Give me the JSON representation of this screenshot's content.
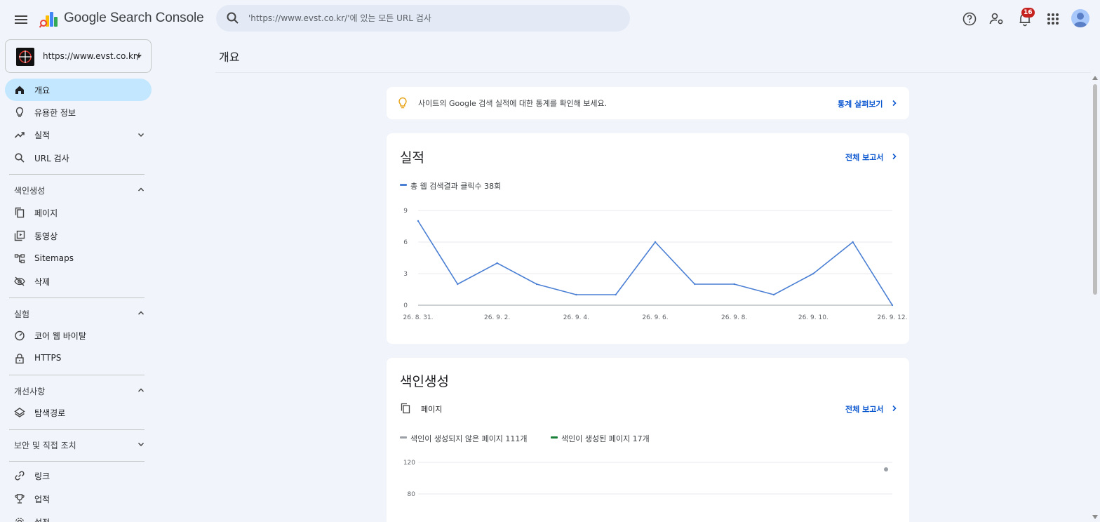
{
  "app": {
    "title": "Google Search Console"
  },
  "search": {
    "placeholder": "'https://www.evst.co.kr/'에 있는 모든 URL 검사"
  },
  "notifications": {
    "count": "16"
  },
  "property": {
    "url": "https://www.evst.co.kr/"
  },
  "sidebar": {
    "overview": "개요",
    "insights": "유용한 정보",
    "performance": "실적",
    "url_inspection": "URL 검사",
    "indexing_section": "색인생성",
    "pages": "페이지",
    "videos": "동영상",
    "sitemaps": "Sitemaps",
    "removals": "삭제",
    "experience_section": "실험",
    "core_web_vitals": "코어 웹 바이탈",
    "https": "HTTPS",
    "enhancements_section": "개선사항",
    "breadcrumbs": "탐색경로",
    "security_section": "보안 및 직접 조치",
    "links": "링크",
    "achievements": "업적",
    "settings": "설정"
  },
  "main": {
    "page_title": "개요",
    "tip": {
      "text": "사이트의 Google 검색 실적에 대한 통계를 확인해 보세요.",
      "link": "통계 살펴보기"
    },
    "performance": {
      "title": "실적",
      "link": "전체 보고서",
      "legend": "총 웹 검색결과 클릭수 38회"
    },
    "indexing": {
      "title": "색인생성",
      "subtitle": "페이지",
      "link": "전체 보고서",
      "legend_not_indexed": "색인이 생성되지 않은 페이지 111개",
      "legend_indexed": "색인이 생성된 페이지 17개"
    }
  },
  "colors": {
    "accent": "#0b57d0",
    "line": "#4a7fd4",
    "active_nav": "#c2e7ff",
    "indexed": "#188038",
    "not_indexed": "#9aa0a6"
  },
  "chart_data": [
    {
      "type": "line",
      "title": "",
      "x_tick_labels": [
        "26. 8. 31.",
        "26. 9. 2.",
        "26. 9. 4.",
        "26. 9. 6.",
        "26. 9. 8.",
        "26. 9. 10.",
        "26. 9. 12."
      ],
      "x": [
        "26. 8. 31.",
        "26. 9. 1.",
        "26. 9. 2.",
        "26. 9. 3.",
        "26. 9. 4.",
        "26. 9. 5.",
        "26. 9. 6.",
        "26. 9. 7.",
        "26. 9. 8.",
        "26. 9. 9.",
        "26. 9. 10.",
        "26. 9. 11.",
        "26. 9. 12."
      ],
      "series": [
        {
          "name": "총 웹 검색결과 클릭수 38회",
          "values": [
            8,
            2,
            4,
            2,
            1,
            1,
            6,
            2,
            2,
            1,
            3,
            6,
            0
          ]
        }
      ],
      "y_ticks": [
        0,
        3,
        6,
        9
      ],
      "ylim": [
        0,
        9
      ],
      "grid": true
    },
    {
      "type": "line",
      "title": "",
      "y_ticks": [
        80,
        120
      ],
      "series": [
        {
          "name": "색인이 생성되지 않은 페이지 111개",
          "values": []
        },
        {
          "name": "색인이 생성된 페이지 17개",
          "values": []
        }
      ],
      "grid": true
    }
  ]
}
